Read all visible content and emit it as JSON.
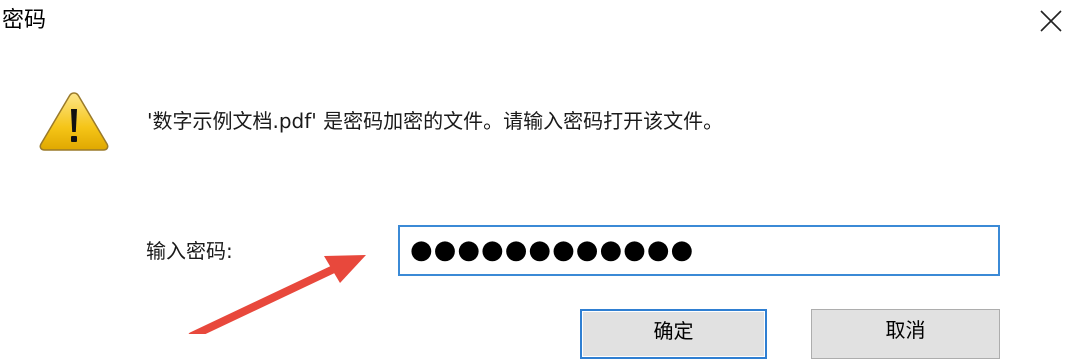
{
  "dialog": {
    "title": "密码",
    "message": "'数字示例文档.pdf' 是密码加密的文件。请输入密码打开该文件。"
  },
  "password": {
    "label": "输入密码:",
    "value": "●●●●●●●●●●●●"
  },
  "buttons": {
    "ok_label": "确定",
    "cancel_label": "取消"
  },
  "icons": {
    "warning": "warning-triangle-icon",
    "close": "close-icon"
  },
  "colors": {
    "focus_border": "#3b8ad6",
    "warning_fill": "#f5c518",
    "annotation_arrow": "#e8483c"
  }
}
